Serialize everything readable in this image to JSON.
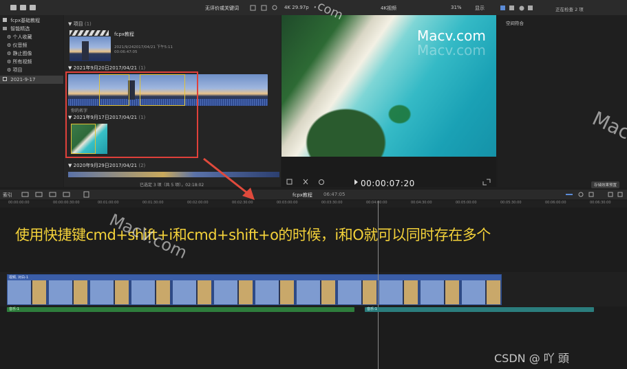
{
  "sidebar": {
    "library": "fcpx基础教程",
    "smart_collections": "智能精选",
    "items": [
      "个人收藏",
      "仪音频",
      "静止图像",
      "所有视频",
      "项目"
    ],
    "event": "2021-9-17"
  },
  "browser": {
    "filter": "无评价或关键词",
    "projects_header": "项目",
    "projects_count": "(1)",
    "project_name": "fcpx教程",
    "project_date": "2021/9/242017/04/21 下午5:11",
    "project_duration": "00:06:47:05",
    "group1_title": "2021年9月20日2017/04/21",
    "group1_count": "(1)",
    "clip1_label": "你的名字",
    "group2_title": "2021年9月17日2017/04/21",
    "group2_count": "(1)",
    "group3_title": "2020年9月29日2017/04/21",
    "group3_count": "(2)",
    "status": "已选定 3 项（共 5 项），02:18:02"
  },
  "viewer": {
    "format": "4K 29.97p",
    "title": "4K视频",
    "zoom": "31%",
    "display": "显示",
    "timecode": "00:00:07:20"
  },
  "inspector": {
    "status": "正在检查 2 项",
    "section": "空间符合",
    "footer_button": "存储效果预置"
  },
  "timeline": {
    "index_label": "索引",
    "project": "fcpx教程",
    "duration": "06:47:05",
    "ruler": [
      "00:00:00:00",
      "00:00:00:30:00",
      "00:01:00:00",
      "00:01:30:00",
      "00:02:00:00",
      "00:02:30:00",
      "00:03:00:00",
      "00:03:30:00",
      "00:04:00:00",
      "00:04:30:00",
      "00:05:00:00",
      "00:05:30:00",
      "00:06:00:00",
      "00:06:30:00"
    ],
    "video_clip_label": "视频, 对白-1",
    "audio1_label": "音乐-1",
    "audio2_label": "音乐-1"
  },
  "overlay_caption": "使用快捷键cmd+shift+i和cmd+shift+o的时候，i和O就可以同时存在多个",
  "watermarks": {
    "top_right": "Macv.com",
    "top_right_shadow": "Macv.com",
    "right_side": "Mac",
    "center": "MacV.com",
    "top_center": ".com",
    "credit": "CSDN @ 吖  頭 "
  },
  "colors": {
    "highlight_box": "#e0403a",
    "arrow": "#e04a3c",
    "caption": "#f4d23a",
    "selection": "#e2c233",
    "video_track": "#3b5ea8",
    "audio_green": "#2e7d3c",
    "audio_teal": "#2b7d7d"
  }
}
